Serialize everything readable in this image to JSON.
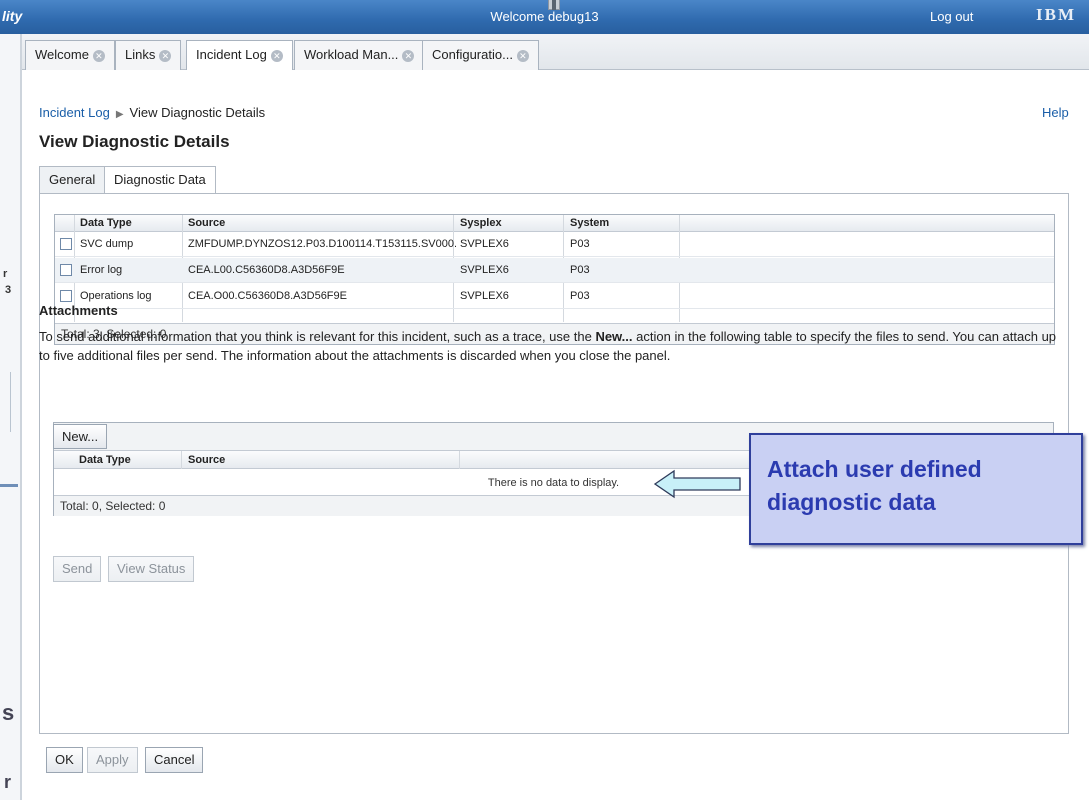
{
  "header": {
    "app_fragment": "lity",
    "welcome": "Welcome debug13",
    "logout": "Log out",
    "logo": "IBM"
  },
  "tabs": [
    {
      "label": "Welcome",
      "close_icon": "close-circle-icon"
    },
    {
      "label": "Links",
      "close_icon": "close-circle-icon"
    },
    {
      "label": "Incident Log",
      "close_icon": "close-circle-icon",
      "active": true
    },
    {
      "label": "Workload Man...",
      "close_icon": "close-circle-icon"
    },
    {
      "label": "Configuratio...",
      "close_icon": "close-circle-icon"
    }
  ],
  "breadcrumb": {
    "link": "Incident Log",
    "separator": "▶",
    "current": "View Diagnostic Details"
  },
  "help": "Help",
  "page_title": "View Diagnostic Details",
  "subtabs": [
    {
      "label": "General"
    },
    {
      "label": "Diagnostic Data",
      "active": true
    }
  ],
  "diag_table": {
    "columns": [
      "Data Type",
      "Source",
      "Sysplex",
      "System"
    ],
    "rows": [
      {
        "type": "SVC dump",
        "source": "ZMFDUMP.DYNZOS12.P03.D100114.T153115.SV000.",
        "sysplex": "SVPLEX6",
        "system": "P03"
      },
      {
        "type": "Error log",
        "source": "CEA.L00.C56360D8.A3D56F9E",
        "sysplex": "SVPLEX6",
        "system": "P03"
      },
      {
        "type": "Operations log",
        "source": "CEA.O00.C56360D8.A3D56F9E",
        "sysplex": "SVPLEX6",
        "system": "P03"
      }
    ],
    "footer": "Total: 3, Selected: 0"
  },
  "attachments": {
    "title": "Attachments",
    "desc_part1": "To send additional information that you think is relevant for this incident, such as a trace, use the ",
    "desc_bold": "New...",
    "desc_part2": " action in the following table to specify the files to send. You can attach up to five additional files per send. The information about the attachments is discarded when you close the panel.",
    "new_button": "New...",
    "columns": [
      "Data Type",
      "Source"
    ],
    "empty": "There is no data to display.",
    "footer": "Total: 0, Selected: 0"
  },
  "actions": {
    "send": "Send",
    "view_status": "View Status"
  },
  "bottom": {
    "ok": "OK",
    "apply": "Apply",
    "cancel": "Cancel"
  },
  "callout": {
    "text": "Attach user defined diagnostic data"
  },
  "left_slice": {
    "char1": "r",
    "char2": "3",
    "char3": "s",
    "char4": "r"
  },
  "colors": {
    "header": "#2f6aae",
    "link": "#1a5ea8",
    "callout_bg": "#c9d0f3",
    "callout_text": "#2b3bb0",
    "arrow_fill": "#c8f0f8"
  }
}
